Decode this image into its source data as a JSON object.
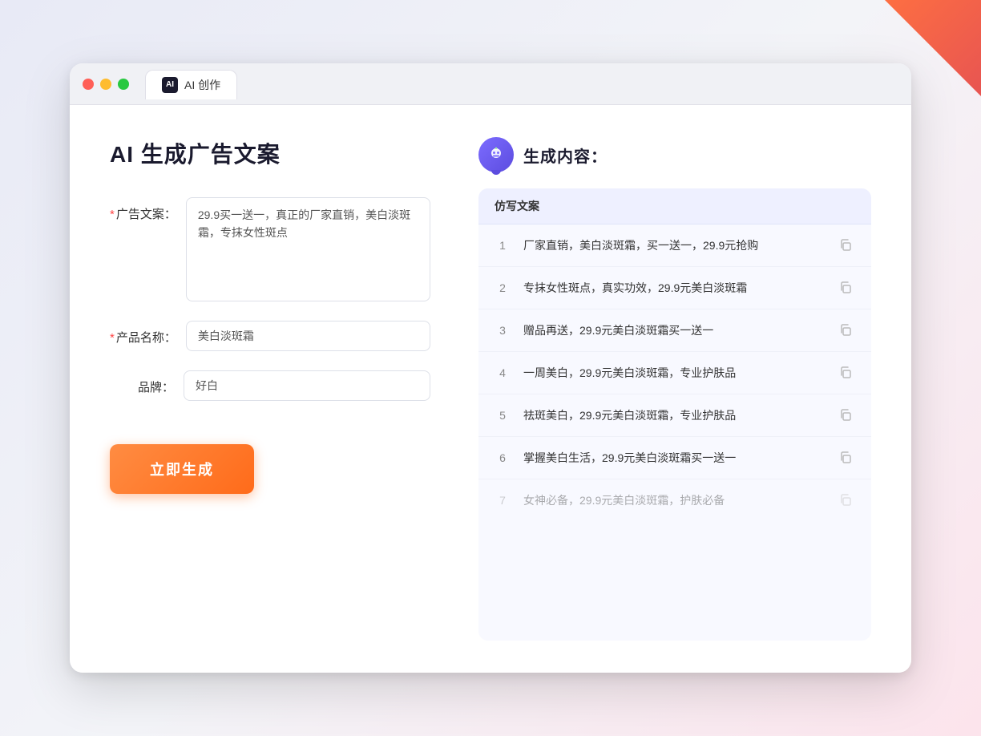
{
  "window": {
    "title": "AI 创作",
    "tab_label": "AI 创作"
  },
  "traffic_lights": {
    "red": "red",
    "yellow": "yellow",
    "green": "green"
  },
  "left_panel": {
    "title": "AI 生成广告文案",
    "form": {
      "ad_copy_label": "广告文案：",
      "ad_copy_required": "*",
      "ad_copy_value": "29.9买一送一，真正的厂家直销，美白淡斑霜，专抹女性斑点",
      "product_name_label": "产品名称：",
      "product_name_required": "*",
      "product_name_value": "美白淡斑霜",
      "brand_label": "品牌：",
      "brand_value": "好白"
    },
    "generate_button": "立即生成"
  },
  "right_panel": {
    "title": "生成内容：",
    "column_header": "仿写文案",
    "results": [
      {
        "num": "1",
        "text": "厂家直销，美白淡斑霜，买一送一，29.9元抢购"
      },
      {
        "num": "2",
        "text": "专抹女性斑点，真实功效，29.9元美白淡斑霜"
      },
      {
        "num": "3",
        "text": "赠品再送，29.9元美白淡斑霜买一送一"
      },
      {
        "num": "4",
        "text": "一周美白，29.9元美白淡斑霜，专业护肤品"
      },
      {
        "num": "5",
        "text": "祛斑美白，29.9元美白淡斑霜，专业护肤品"
      },
      {
        "num": "6",
        "text": "掌握美白生活，29.9元美白淡斑霜买一送一"
      },
      {
        "num": "7",
        "text": "女神必备，29.9元美白淡斑霜，护肤必备",
        "dimmed": true
      }
    ]
  }
}
